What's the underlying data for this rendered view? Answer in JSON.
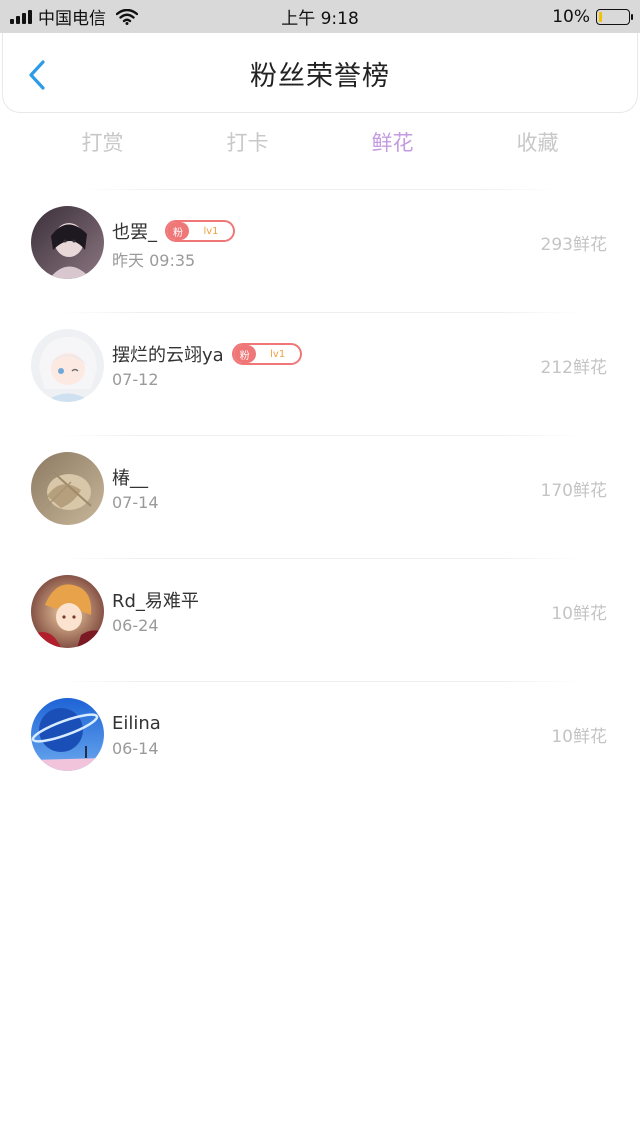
{
  "status_bar": {
    "carrier": "中国电信",
    "time": "上午 9:18",
    "battery": "10%",
    "battery_level": 0.1
  },
  "header": {
    "title": "粉丝荣誉榜"
  },
  "tabs": [
    {
      "label": "打赏",
      "active": false
    },
    {
      "label": "打卡",
      "active": false
    },
    {
      "label": "鲜花",
      "active": true
    },
    {
      "label": "收藏",
      "active": false
    }
  ],
  "fans": [
    {
      "name": "也罢_",
      "time": "昨天 09:35",
      "count": "293鲜花",
      "badge": {
        "tag": "粉",
        "level": "lv1"
      }
    },
    {
      "name": "摆烂的云翊ya",
      "time": "07-12",
      "count": "212鲜花",
      "badge": {
        "tag": "粉",
        "level": "lv1"
      }
    },
    {
      "name": "椿__",
      "time": "07-14",
      "count": "170鲜花"
    },
    {
      "name": "Rd_易难平",
      "time": "06-24",
      "count": "10鲜花"
    },
    {
      "name": "Eilina",
      "time": "06-14",
      "count": "10鲜花"
    }
  ],
  "colors": {
    "tab_active": "#c49be0",
    "badge": "#f07777",
    "back_arrow": "#2e9be6"
  }
}
